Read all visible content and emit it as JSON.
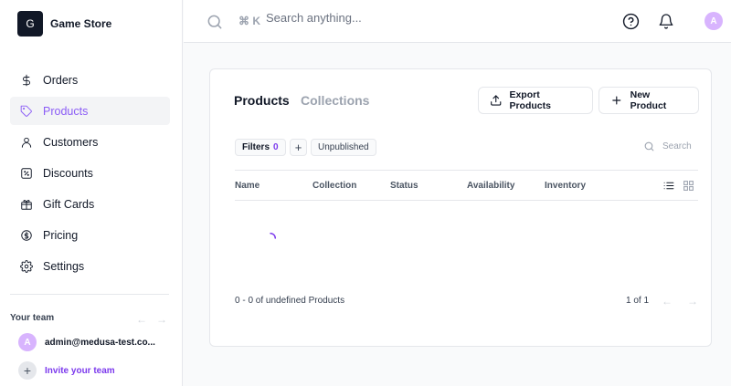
{
  "sidebar": {
    "store": {
      "logo_letter": "G",
      "name": "Game Store"
    },
    "nav": [
      {
        "label": "Orders",
        "icon": "dollar-icon"
      },
      {
        "label": "Products",
        "icon": "tag-icon",
        "active": true
      },
      {
        "label": "Customers",
        "icon": "user-icon"
      },
      {
        "label": "Discounts",
        "icon": "discount-icon"
      },
      {
        "label": "Gift Cards",
        "icon": "gift-icon"
      },
      {
        "label": "Pricing",
        "icon": "pricing-icon"
      },
      {
        "label": "Settings",
        "icon": "gear-icon"
      }
    ],
    "team": {
      "label": "Your team",
      "member": {
        "initial": "A",
        "email": "admin@medusa-test.co..."
      },
      "invite_label": "Invite your team"
    }
  },
  "topbar": {
    "shortcut": "⌘ K",
    "search_placeholder": "Search anything...",
    "avatar_initial": "A"
  },
  "main": {
    "tabs": [
      {
        "label": "Products",
        "active": true
      },
      {
        "label": "Collections",
        "active": false
      }
    ],
    "buttons": {
      "export": "Export Products",
      "new": "New Product"
    },
    "filters": {
      "label": "Filters",
      "count": "0",
      "add": "+",
      "saved_view": "Unpublished"
    },
    "search_placeholder": "Search",
    "columns": [
      "Name",
      "Collection",
      "Status",
      "Availability",
      "Inventory"
    ],
    "pagination": {
      "summary": "0 - 0 of undefined Products",
      "pages": "1 of 1"
    }
  },
  "colors": {
    "accent": "#7c3aed",
    "accent_light": "#d8b4fe"
  }
}
